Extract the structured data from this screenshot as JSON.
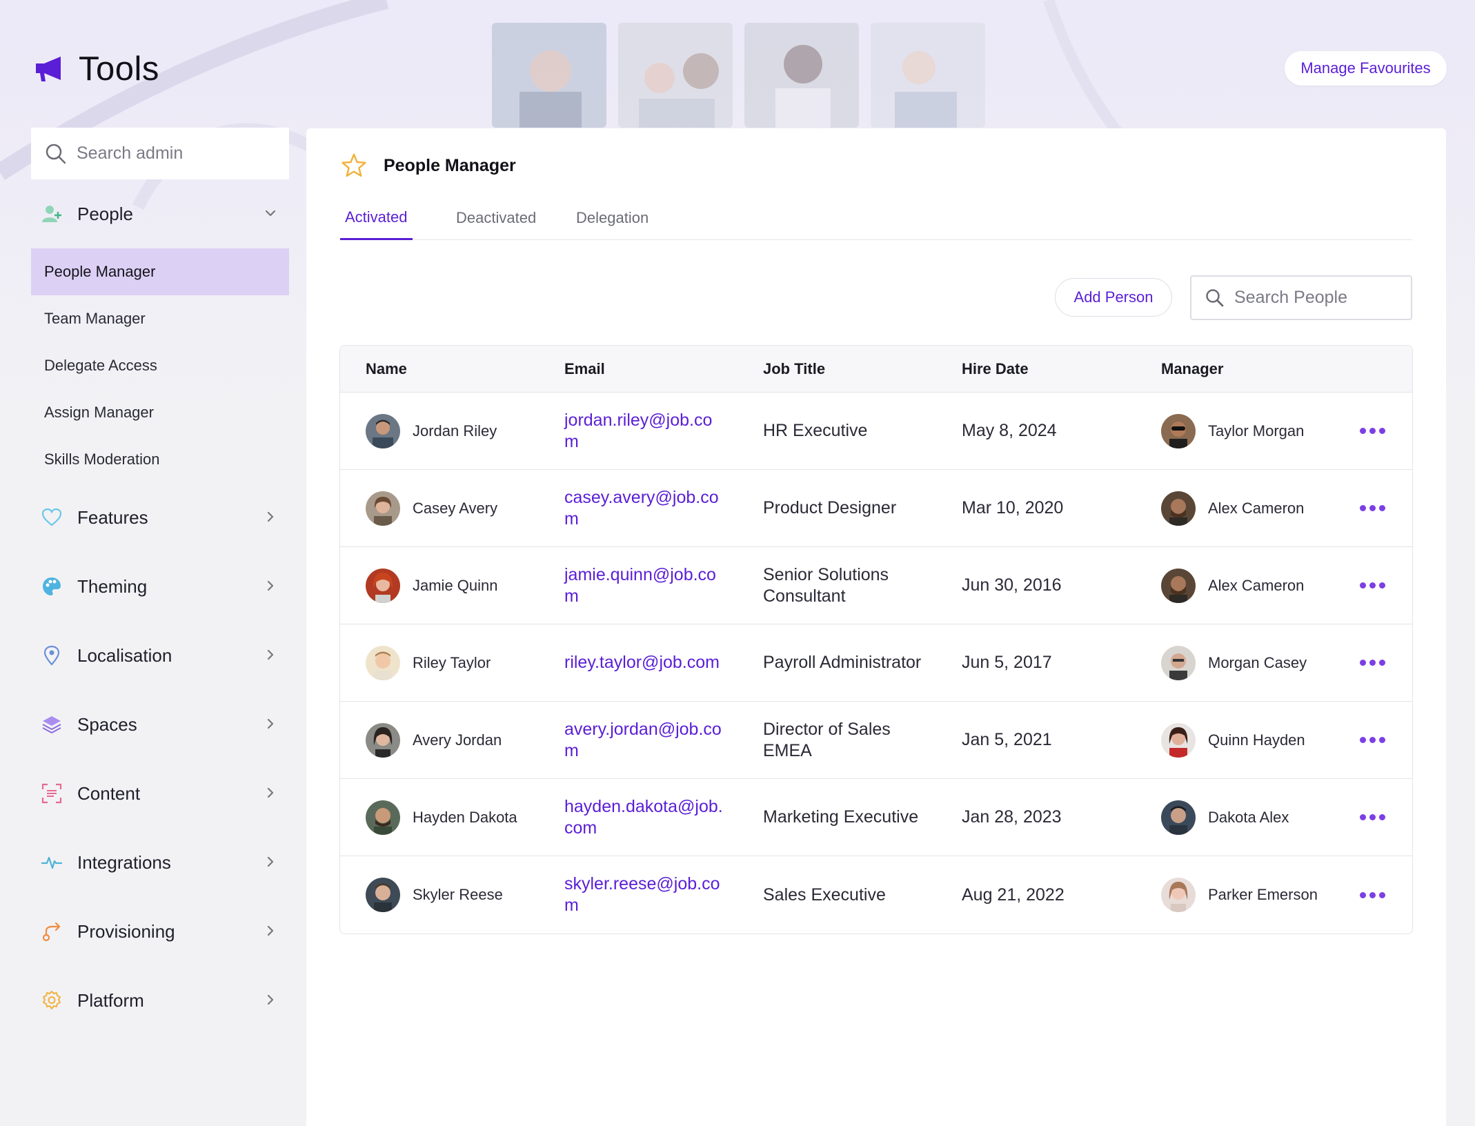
{
  "app": {
    "title": "Tools",
    "manage_favourites": "Manage Favourites"
  },
  "colors": {
    "accent": "#5a1ed6",
    "active_nav_bg": "#ddd0f5"
  },
  "sidebar": {
    "search_placeholder": "Search admin",
    "people": {
      "label": "People",
      "icon": "person-add-icon"
    },
    "people_items": [
      {
        "label": "People Manager",
        "active": true
      },
      {
        "label": "Team Manager"
      },
      {
        "label": "Delegate Access"
      },
      {
        "label": "Assign Manager"
      },
      {
        "label": "Skills Moderation"
      }
    ],
    "groups": [
      {
        "label": "Features",
        "icon": "heart-icon"
      },
      {
        "label": "Theming",
        "icon": "palette-icon"
      },
      {
        "label": "Localisation",
        "icon": "location-pin-icon"
      },
      {
        "label": "Spaces",
        "icon": "layers-icon"
      },
      {
        "label": "Content",
        "icon": "content-scan-icon"
      },
      {
        "label": "Integrations",
        "icon": "pulse-icon"
      },
      {
        "label": "Provisioning",
        "icon": "route-icon"
      },
      {
        "label": "Platform",
        "icon": "gear-icon"
      }
    ]
  },
  "main": {
    "title": "People Manager",
    "tabs": [
      {
        "label": "Activated",
        "active": true
      },
      {
        "label": "Deactivated"
      },
      {
        "label": "Delegation"
      }
    ],
    "add_person": "Add Person",
    "search_placeholder": "Search People",
    "columns": [
      "Name",
      "Email",
      "Job Title",
      "Hire Date",
      "Manager"
    ],
    "rows": [
      {
        "name": "Jordan Riley",
        "email": "jordan.riley@job.com",
        "job": "HR Executive",
        "hire": "May 8, 2024",
        "manager": "Taylor Morgan"
      },
      {
        "name": "Casey Avery",
        "email": "casey.avery@job.com",
        "job": "Product Designer",
        "hire": "Mar 10, 2020",
        "manager": "Alex Cameron"
      },
      {
        "name": "Jamie Quinn",
        "email": "jamie.quinn@job.com",
        "job": "Senior Solutions Consultant",
        "hire": "Jun 30, 2016",
        "manager": "Alex Cameron"
      },
      {
        "name": "Riley Taylor",
        "email": "riley.taylor@job.com",
        "job": "Payroll Administrator",
        "hire": "Jun 5, 2017",
        "manager": "Morgan Casey"
      },
      {
        "name": "Avery Jordan",
        "email": "avery.jordan@job.com",
        "job": "Director of Sales EMEA",
        "hire": "Jan 5, 2021",
        "manager": "Quinn Hayden"
      },
      {
        "name": "Hayden Dakota",
        "email": "hayden.dakota@job.com",
        "job": "Marketing Executive",
        "hire": "Jan 28, 2023",
        "manager": "Dakota Alex"
      },
      {
        "name": "Skyler Reese",
        "email": "skyler.reese@job.com",
        "job": "Sales Executive",
        "hire": "Aug 21, 2022",
        "manager": "Parker Emerson"
      }
    ]
  }
}
